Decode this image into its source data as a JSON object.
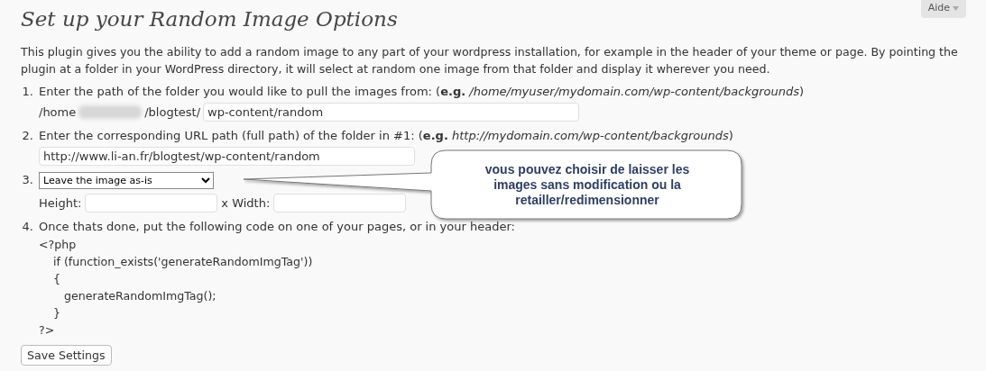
{
  "help_button": {
    "label": "Aide"
  },
  "title": "Set up your Random Image Options",
  "intro": "This plugin gives you the ability to add a random image to any part of your wordpress installation, for example in the header of your theme or page. By pointing the plugin at a folder in your WordPress directory, it will select at random one image from that folder and display it wherever you need.",
  "steps": [
    {
      "kind": "path",
      "number": "1.",
      "text": "Enter the path of the folder you would like to pull the images from: (**e.g.** */home/myuser/mydomain.com/wp-content/backgrounds*)",
      "prefix": "/home",
      "suffix": "/blogtest/",
      "value": "wp-content/random"
    },
    {
      "kind": "url",
      "number": "2.",
      "text": "Enter the corresponding URL path (full path) of the folder in #1: (**e.g.** *http://mydomain.com/wp-content/backgrounds*)",
      "value": "http://www.li-an.fr/blogtest/wp-content/random"
    },
    {
      "kind": "resize",
      "number": "3.",
      "select_value": "Leave the image as-is",
      "height_label": "Height:",
      "width_label": "x Width:"
    },
    {
      "kind": "code",
      "number": "4.",
      "text": "Once thats done, put the following code on one of your pages, or in your header:",
      "code": [
        "<?php",
        "    if (function_exists('generateRandomImgTag'))",
        "    {",
        "       generateRandomImgTag();",
        "    }",
        "?>"
      ]
    }
  ],
  "save_button": "Save Settings",
  "callout": "vous pouvez choisir de laisser les images sans modification ou la retailler/redimensionner"
}
